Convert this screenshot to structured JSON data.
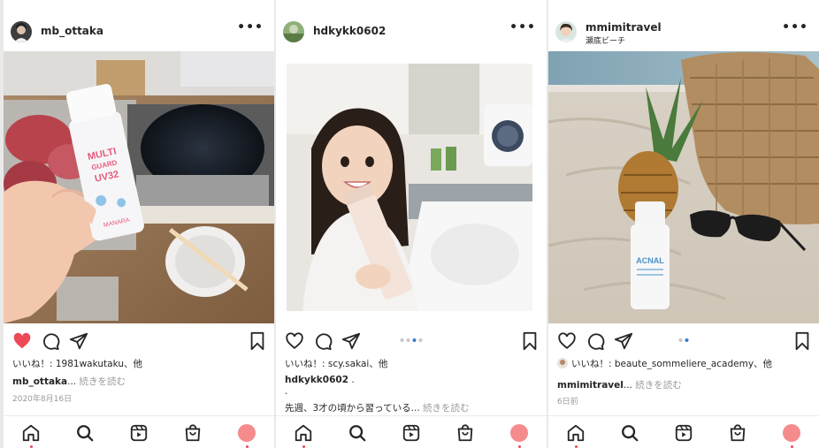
{
  "posts": [
    {
      "username": "mb_ottaka",
      "location": "",
      "liked": true,
      "carousel": false,
      "likes_text": "いいね！: 1981wakutaku、他",
      "caption_user": "mb_ottaka",
      "caption_text": "...",
      "more_label": "続きを読む",
      "date": "2020年8月16日",
      "product_text": "MULTI GUARD UV32",
      "product_brand": "MANARA"
    },
    {
      "username": "hdkykk0602",
      "location": "",
      "liked": false,
      "carousel": true,
      "carousel_index": 2,
      "carousel_count": 4,
      "likes_text": "いいね！: scy.sakai、他",
      "caption_user": "hdkykk0602",
      "caption_text": " .",
      "caption_line2": ".",
      "caption_line3": "先週、3才の頃から習っている...",
      "more_label": "続きを読む"
    },
    {
      "username": "mmimitravel",
      "location": "瀬底ビーチ",
      "liked": false,
      "carousel": true,
      "carousel_index": 1,
      "carousel_count": 2,
      "likes_text": "いいね！: beaute_sommeliere_academy、他",
      "caption_user": "mmimitravel",
      "caption_text": "...",
      "more_label": "続きを読む",
      "date": "6日前",
      "product_text": "ACNAL"
    }
  ],
  "nav": {
    "items": [
      "home-icon",
      "search-icon",
      "reels-icon",
      "shop-icon",
      "profile-avatar"
    ]
  },
  "colors": {
    "like_red": "#ed4956",
    "carousel_active": "#3a7bd5",
    "profile_pink": "#f58b8d",
    "secondary_text": "#9a9a9a"
  }
}
